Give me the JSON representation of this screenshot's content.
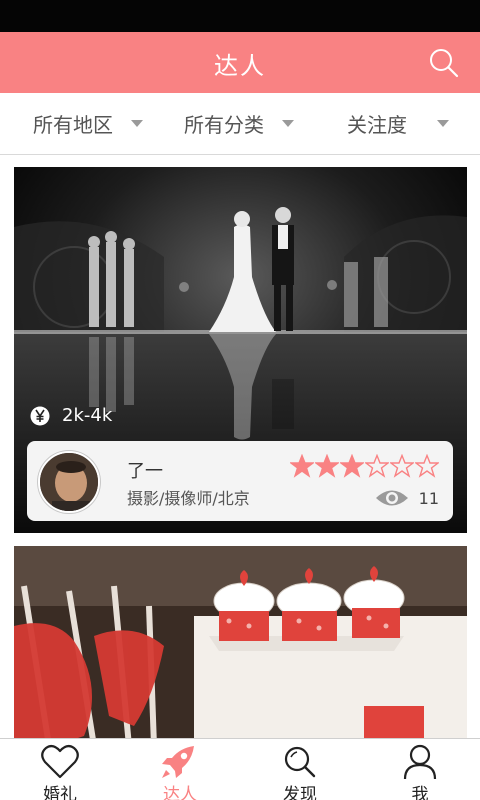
{
  "header": {
    "title": "达人",
    "search_icon": "search-icon"
  },
  "filters": [
    {
      "label": "所有地区"
    },
    {
      "label": "所有分类"
    },
    {
      "label": "关注度"
    }
  ],
  "cards": [
    {
      "image": "wedding-couple-stage-photo",
      "price": "2k-4k",
      "price_icon": "yen-icon",
      "name": "了一",
      "tags": "摄影/摄像师/北京",
      "rating": 3,
      "rating_max": 6,
      "views": "11",
      "views_icon": "eye-icon"
    },
    {
      "image": "wedding-cupcakes-photo"
    }
  ],
  "tabbar": {
    "active": 1,
    "items": [
      {
        "label": "婚礼",
        "icon": "heart-icon"
      },
      {
        "label": "达人",
        "icon": "rocket-icon"
      },
      {
        "label": "发现",
        "icon": "search-icon"
      },
      {
        "label": "我",
        "icon": "person-icon"
      }
    ]
  },
  "colors": {
    "accent": "#f98283",
    "status_bar": "#050505",
    "star": "#f98283"
  }
}
